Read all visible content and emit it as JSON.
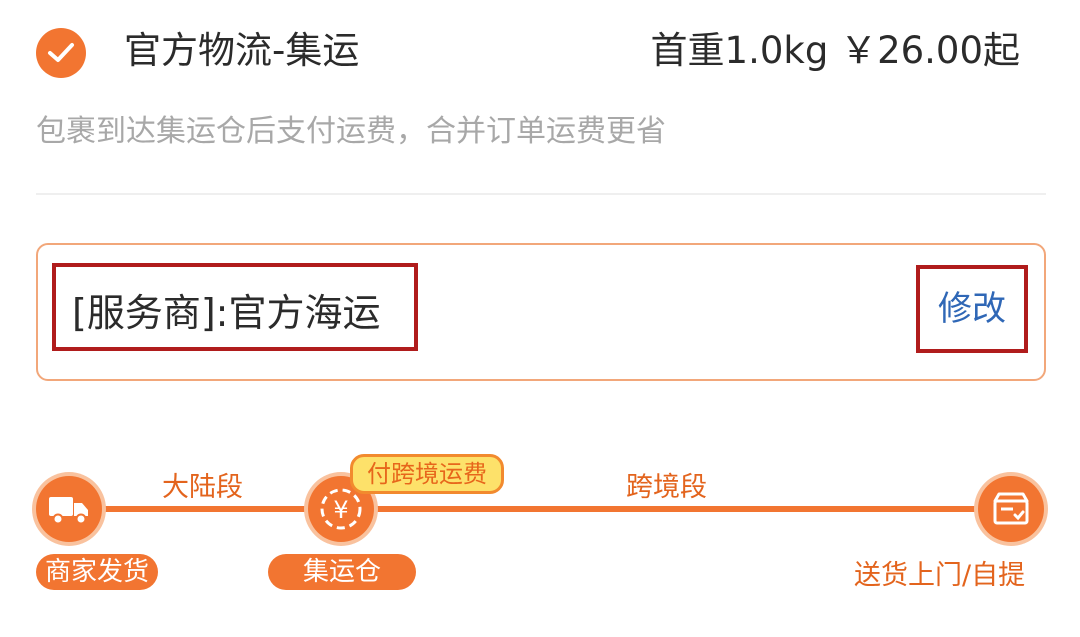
{
  "header": {
    "title": "官方物流-集运",
    "price": "首重1.0kg ￥26.00起",
    "description": "包裹到达集运仓后支付运费，合并订单运费更省"
  },
  "provider": {
    "label": "[服务商]:官方海运",
    "edit_label": "修改"
  },
  "flow": {
    "segment_mainland": "大陆段",
    "segment_crossborder": "跨境段",
    "badge_pay": "付跨境运费",
    "step_merchant_ship": "商家发货",
    "step_warehouse": "集运仓",
    "step_delivery": "送货上门/自提",
    "yen_symbol": "¥"
  },
  "colors": {
    "accent": "#f27531",
    "link": "#2f67b6",
    "highlight_frame": "#b01c1c",
    "badge_bg": "#fde16a"
  },
  "icons": {
    "selected": "check-icon",
    "merchant": "truck-icon",
    "warehouse": "yen-icon",
    "delivery": "box-icon"
  }
}
